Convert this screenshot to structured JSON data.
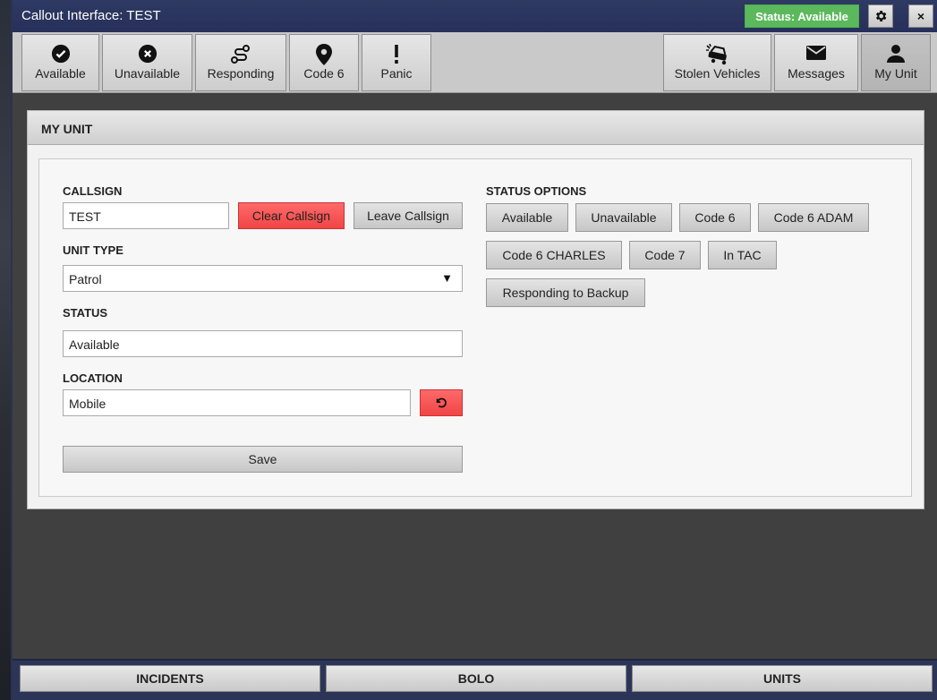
{
  "window": {
    "title": "Callout Interface: TEST",
    "status_pill": "Status: Available",
    "settings_icon": "gear-icon",
    "close_label": "×"
  },
  "toolbar": {
    "left": [
      {
        "label": "Available",
        "icon": "check-circle-icon"
      },
      {
        "label": "Unavailable",
        "icon": "x-circle-icon"
      },
      {
        "label": "Responding",
        "icon": "route-icon"
      },
      {
        "label": "Code 6",
        "icon": "map-pin-icon"
      },
      {
        "label": "Panic",
        "icon": "exclamation-icon"
      }
    ],
    "right": [
      {
        "label": "Stolen Vehicles",
        "icon": "car-crash-icon"
      },
      {
        "label": "Messages",
        "icon": "envelope-icon"
      },
      {
        "label": "My Unit",
        "icon": "user-icon"
      }
    ]
  },
  "panel": {
    "header": "MY UNIT",
    "callsign": {
      "label": "CALLSIGN",
      "value": "TEST",
      "clear_label": "Clear Callsign",
      "leave_label": "Leave Callsign"
    },
    "unit_type": {
      "label": "UNIT TYPE",
      "value": "Patrol",
      "arrow": "▼"
    },
    "status": {
      "label": "STATUS",
      "value": "Available"
    },
    "location": {
      "label": "LOCATION",
      "value": "Mobile",
      "reset_icon": "undo-icon"
    },
    "save_label": "Save",
    "status_options": {
      "label": "STATUS OPTIONS",
      "options": [
        "Available",
        "Unavailable",
        "Code 6",
        "Code 6 ADAM",
        "Code 6 CHARLES",
        "Code 7",
        "In TAC",
        "Responding to Backup"
      ]
    }
  },
  "bottom_tabs": [
    "INCIDENTS",
    "BOLO",
    "UNITS"
  ],
  "colors": {
    "titlebar": "#2f3a63",
    "status_green": "#5cb85c",
    "danger_red": "#f04545",
    "background": "#404040"
  }
}
